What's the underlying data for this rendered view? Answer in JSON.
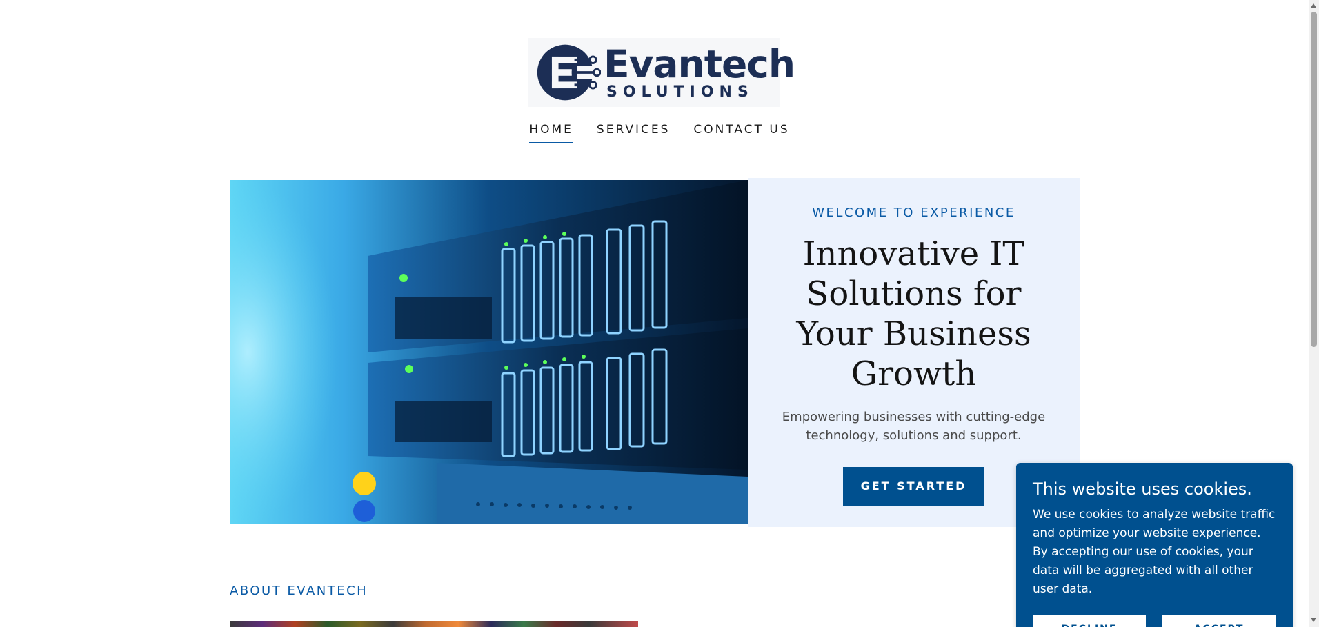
{
  "header": {
    "logo": {
      "name": "Evantech",
      "sub": "SOLUTIONS",
      "mark_icon": "circuit-e-logo-icon",
      "color": "#1c2e55"
    },
    "nav": [
      {
        "label": "HOME",
        "active": true
      },
      {
        "label": "SERVICES",
        "active": false
      },
      {
        "label": "CONTACT US",
        "active": false
      }
    ]
  },
  "hero": {
    "eyebrow": "WELCOME TO EXPERIENCE",
    "title": "Innovative IT Solutions for Your Business Growth",
    "description": "Empowering businesses with cutting-edge technology, solutions and support.",
    "button_label": "GET STARTED",
    "image": "server-rack-photo",
    "panel_color": "#ebf2fd",
    "accent_color": "#00508f"
  },
  "about": {
    "heading": "ABOUT EVANTECH"
  },
  "cookie_banner": {
    "title": "This website uses cookies.",
    "text": "We use cookies to analyze website traffic and optimize your website experience. By accepting our use of cookies, your data will be aggregated with all other user data.",
    "decline_label": "DECLINE",
    "accept_label": "ACCEPT",
    "color": "#00508f"
  }
}
